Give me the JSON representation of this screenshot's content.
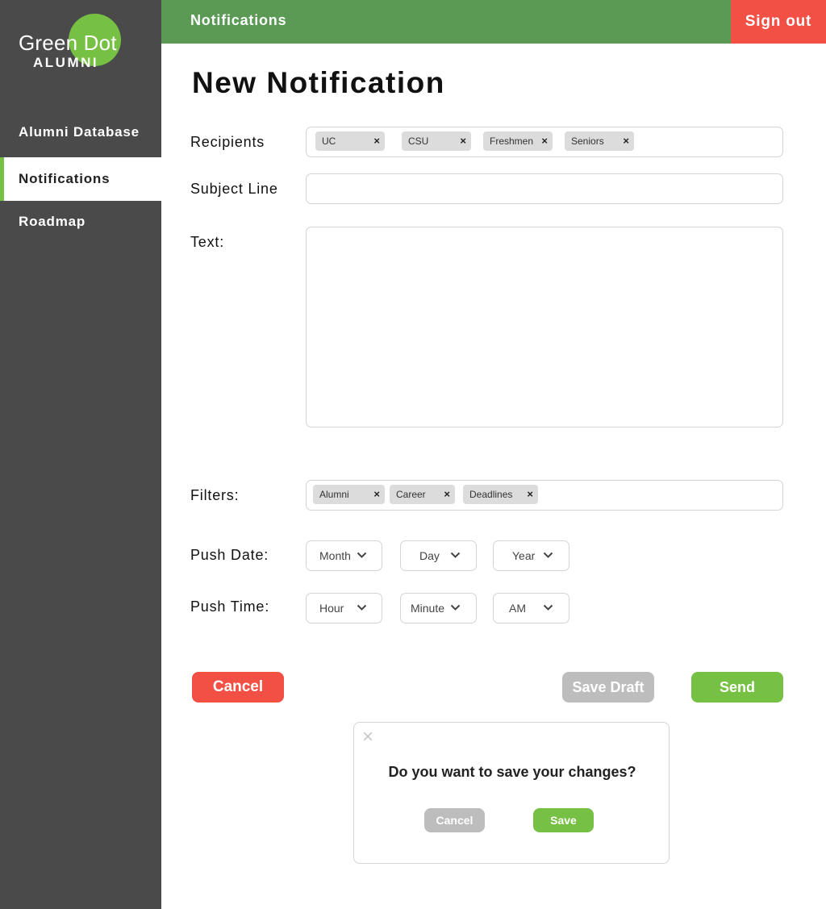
{
  "logo": {
    "top": "Green Dot",
    "bottom": "ALUMNI"
  },
  "sidebar": {
    "items": [
      {
        "label": "Alumni Database",
        "active": false
      },
      {
        "label": "Notifications",
        "active": true
      },
      {
        "label": "Roadmap",
        "active": false
      }
    ]
  },
  "topbar": {
    "title": "Notifications",
    "signout_label": "Sign out"
  },
  "page": {
    "title": "New Notification"
  },
  "form": {
    "recipients_label": "Recipients",
    "recipients": [
      "UC",
      "CSU",
      "Freshmen",
      "Seniors"
    ],
    "subject_label": "Subject Line",
    "subject_value": "",
    "text_label": "Text:",
    "text_value": "",
    "filters_label": "Filters:",
    "filters": [
      "Alumni",
      "Career",
      "Deadlines"
    ],
    "push_date_label": "Push Date:",
    "push_date": {
      "month": "Month",
      "day": "Day",
      "year": "Year"
    },
    "push_time_label": "Push Time:",
    "push_time": {
      "hour": "Hour",
      "minute": "Minute",
      "ampm": "AM"
    }
  },
  "actions": {
    "cancel": "Cancel",
    "save_draft": "Save Draft",
    "send": "Send"
  },
  "dialog": {
    "close": "×",
    "message": "Do you want to save your changes?",
    "cancel": "Cancel",
    "save": "Save"
  },
  "chip_remove": "×",
  "colors": {
    "sidebar": "#4a4a4a",
    "topbar": "#5a9a55",
    "accent_green": "#76c043",
    "danger": "#f25044",
    "disabled": "#bdbdbd"
  },
  "icons": {
    "dropdown": "chevron-down-icon",
    "remove": "close-icon"
  }
}
